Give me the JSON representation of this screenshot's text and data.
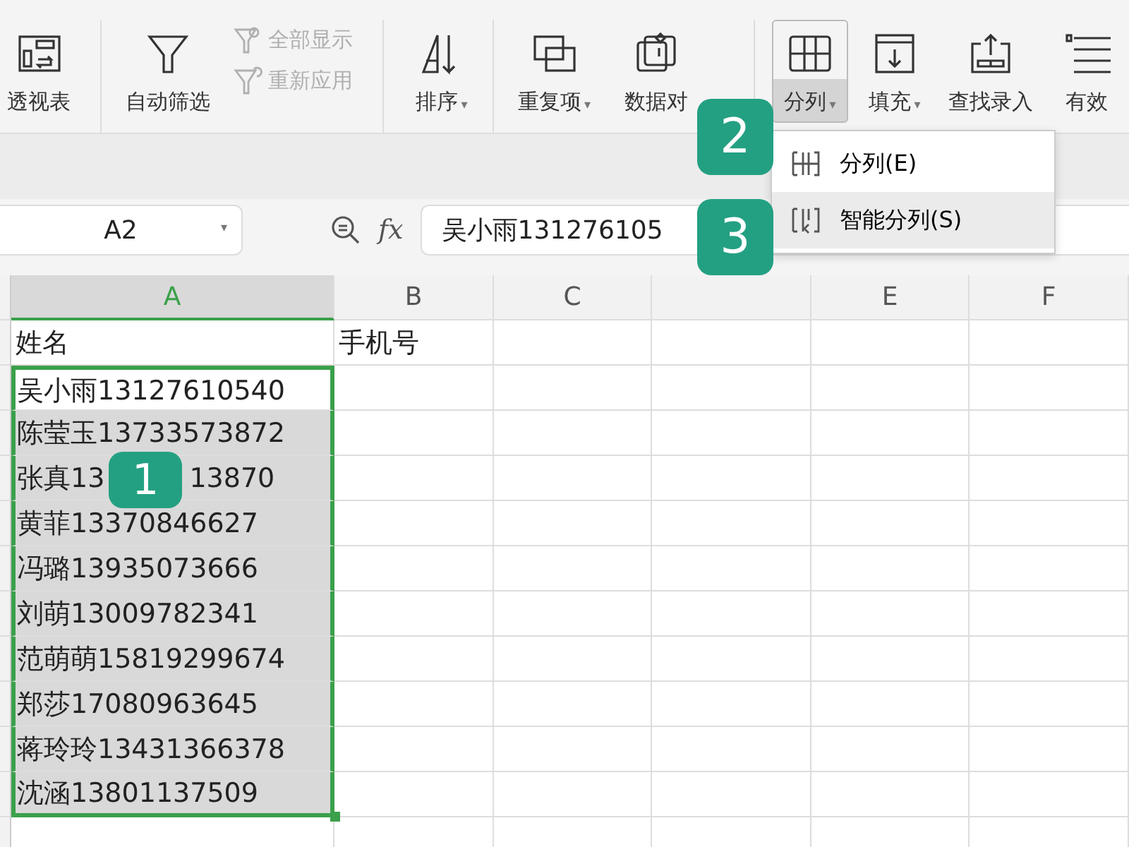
{
  "ribbon": {
    "groups": [
      {
        "items": [
          {
            "kind": "pivot",
            "label": "透视表",
            "selected": false
          }
        ]
      },
      {
        "items": [
          {
            "kind": "filter",
            "label": "自动筛选",
            "selected": false
          },
          {
            "kind": "stack",
            "subs": [
              {
                "kind": "show",
                "label": "全部显示",
                "disabled": true
              },
              {
                "kind": "reapply",
                "label": "重新应用",
                "disabled": true
              }
            ]
          }
        ]
      },
      {
        "items": [
          {
            "kind": "sort",
            "label": "排序",
            "caret": "▾",
            "selected": false
          }
        ]
      },
      {
        "items": [
          {
            "kind": "duplicate",
            "label": "重复项",
            "caret": "▾",
            "selected": false
          },
          {
            "kind": "compare",
            "label": "数据对",
            "selected": false
          }
        ]
      },
      {
        "items": [
          {
            "kind": "split",
            "label": "分列",
            "caret": "▾",
            "selected": true
          },
          {
            "kind": "fill",
            "label": "填充",
            "caret": "▾",
            "selected": false
          },
          {
            "kind": "lookup",
            "label": "查找录入",
            "selected": false
          },
          {
            "kind": "validity",
            "label": "有效",
            "selected": false
          }
        ]
      }
    ]
  },
  "split_menu": {
    "items": [
      {
        "kind": "split",
        "label": "分列(E)",
        "selected": false
      },
      {
        "kind": "smart",
        "label": "智能分列(S)",
        "selected": true
      }
    ]
  },
  "name_box": {
    "value": "A2",
    "caret": "▾"
  },
  "fx": "fx",
  "formula": "吴小雨131276105",
  "columns": [
    {
      "label": "A",
      "selected": true
    },
    {
      "label": "B",
      "selected": false
    },
    {
      "label": "C",
      "selected": false
    },
    {
      "selected": false
    },
    {
      "label": "E",
      "selected": false
    },
    {
      "label": "F",
      "selected": false
    }
  ],
  "rows": [
    {
      "a": "姓名",
      "b": "手机号",
      "selected": false
    },
    {
      "a": "吴小雨13127610540",
      "selected": true
    },
    {
      "a": "陈莹玉13733573872",
      "selected": true
    },
    {
      "a": "张真13",
      "a_after": "13870",
      "selected": true
    },
    {
      "a": "黄菲13370846627",
      "selected": true
    },
    {
      "a": "冯璐13935073666",
      "selected": true
    },
    {
      "a": "刘萌13009782341",
      "selected": true
    },
    {
      "a": "范萌萌15819299674",
      "selected": true
    },
    {
      "a": "郑莎17080963645",
      "selected": true
    },
    {
      "a": "蒋玲玲13431366378",
      "selected": true
    },
    {
      "a": "沈涵13801137509",
      "selected": true
    }
  ],
  "badges": [
    "1",
    "2",
    "3"
  ]
}
